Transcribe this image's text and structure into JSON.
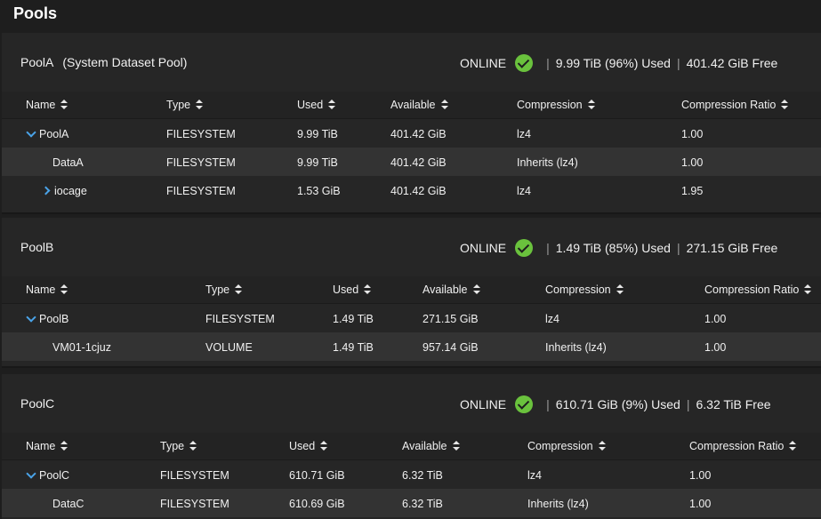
{
  "page": {
    "title": "Pools"
  },
  "pools": [
    {
      "name": "PoolA",
      "subtitle": "(System Dataset Pool)",
      "status": "ONLINE",
      "used": "9.99 TiB (96%) Used",
      "free": "401.42 GiB Free",
      "columns": [
        "Name",
        "Type",
        "Used",
        "Available",
        "Compression",
        "Compression Ratio"
      ],
      "rows": [
        {
          "name": "PoolA",
          "type": "FILESYSTEM",
          "used": "9.99 TiB",
          "available": "401.42 GiB",
          "compression": "lz4",
          "ratio": "1.00",
          "expander": "expanded"
        },
        {
          "name": "DataA",
          "type": "FILESYSTEM",
          "used": "9.99 TiB",
          "available": "401.42 GiB",
          "compression": "Inherits (lz4)",
          "ratio": "1.00",
          "expander": "none"
        },
        {
          "name": "iocage",
          "type": "FILESYSTEM",
          "used": "1.53 GiB",
          "available": "401.42 GiB",
          "compression": "lz4",
          "ratio": "1.95",
          "expander": "collapsed"
        }
      ]
    },
    {
      "name": "PoolB",
      "subtitle": "",
      "status": "ONLINE",
      "used": "1.49 TiB (85%) Used",
      "free": "271.15 GiB Free",
      "columns": [
        "Name",
        "Type",
        "Used",
        "Available",
        "Compression",
        "Compression Ratio"
      ],
      "rows": [
        {
          "name": "PoolB",
          "type": "FILESYSTEM",
          "used": "1.49 TiB",
          "available": "271.15 GiB",
          "compression": "lz4",
          "ratio": "1.00",
          "expander": "expanded"
        },
        {
          "name": "VM01-1cjuz",
          "type": "VOLUME",
          "used": "1.49 TiB",
          "available": "957.14 GiB",
          "compression": "Inherits (lz4)",
          "ratio": "1.00",
          "expander": "none"
        }
      ]
    },
    {
      "name": "PoolC",
      "subtitle": "",
      "status": "ONLINE",
      "used": "610.71 GiB (9%) Used",
      "free": "6.32 TiB Free",
      "columns": [
        "Name",
        "Type",
        "Used",
        "Available",
        "Compression",
        "Compression Ratio"
      ],
      "rows": [
        {
          "name": "PoolC",
          "type": "FILESYSTEM",
          "used": "610.71 GiB",
          "available": "6.32 TiB",
          "compression": "lz4",
          "ratio": "1.00",
          "expander": "expanded"
        },
        {
          "name": "DataC",
          "type": "FILESYSTEM",
          "used": "610.69 GiB",
          "available": "6.32 TiB",
          "compression": "Inherits (lz4)",
          "ratio": "1.00",
          "expander": "none"
        }
      ]
    }
  ],
  "icons": {
    "status": "check-circle-icon",
    "sort": "sort-icon",
    "expand": "chevron-down-icon",
    "collapse": "chevron-right-icon"
  },
  "colors": {
    "accent": "#4aa3e8",
    "online": "#6ac23d"
  }
}
